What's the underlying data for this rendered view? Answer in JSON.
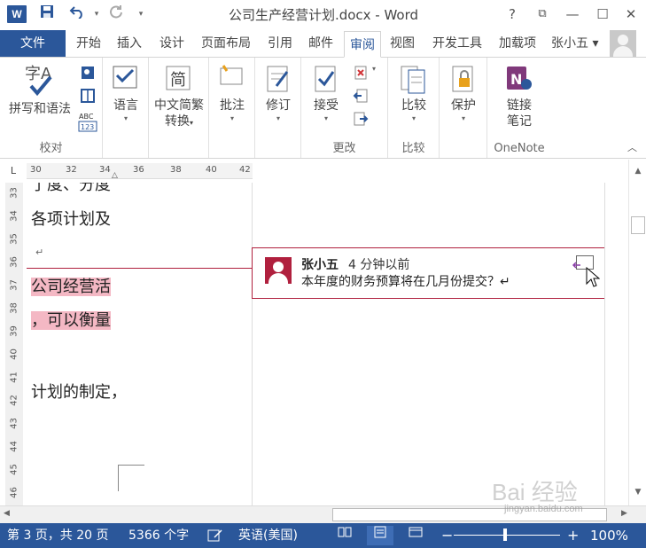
{
  "titlebar": {
    "app_icon": "W",
    "title": "公司生产经营计划.docx - Word",
    "help": "?",
    "ribbon_display": "⧉",
    "minimize": "—",
    "maximize": "☐",
    "close": "✕"
  },
  "tabs": {
    "file": "文件",
    "items": [
      "开始",
      "插入",
      "设计",
      "页面布局",
      "引用",
      "邮件",
      "审阅",
      "视图",
      "开发工具",
      "加载项"
    ],
    "active": "审阅",
    "user_name": "张小五 ▾"
  },
  "ribbon": {
    "proofing": {
      "spell": "拼写和语法",
      "label": "校对"
    },
    "language": {
      "btn": "语言"
    },
    "chinese": {
      "btn_line1": "中文简繁",
      "btn_line2": "转换"
    },
    "comments": {
      "btn": "批注"
    },
    "tracking": {
      "btn": "修订"
    },
    "changes": {
      "accept": "接受",
      "label": "更改"
    },
    "compare": {
      "btn": "比较",
      "label": "比较"
    },
    "protect": {
      "btn": "保护"
    },
    "onenote": {
      "btn_line1": "链接",
      "btn_line2": "笔记",
      "label": "OneNote"
    },
    "dropdown": "▾"
  },
  "ruler": {
    "corner": "L",
    "h_ticks": [
      "30",
      "32",
      "34",
      "36",
      "38",
      "40",
      "42"
    ],
    "v_ticks": [
      "33",
      "34",
      "35",
      "36",
      "37",
      "38",
      "39",
      "40",
      "41",
      "42",
      "43",
      "44",
      "45",
      "46"
    ]
  },
  "document": {
    "lines": [
      "了度、分度",
      "各项计划及",
      "公司经营活",
      "，可以衡量",
      "计划的制定，"
    ],
    "pilcrow": "↵"
  },
  "comment": {
    "author": "张小五",
    "time": "4 分钟以前",
    "text": "本年度的财务预算将在几月份提交？↵"
  },
  "statusbar": {
    "page": "第 3 页，共 20 页",
    "words": "5366 个字",
    "language": "英语(美国)",
    "zoom_minus": "−",
    "zoom_plus": "+",
    "zoom": "100%",
    "zoom_level_percent": 100
  },
  "watermark": {
    "brand": "Bai 经验",
    "url": "jingyan.baidu.com"
  }
}
